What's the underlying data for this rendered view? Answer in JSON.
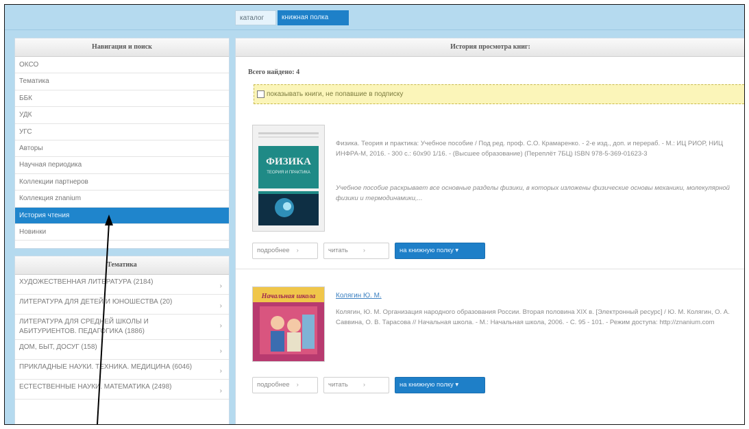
{
  "tabs": [
    {
      "label": "каталог"
    },
    {
      "label": "книжная полка"
    }
  ],
  "nav_panel": {
    "title": "Навигация и поиск",
    "items": [
      {
        "label": "ОКСО"
      },
      {
        "label": "Тематика"
      },
      {
        "label": "ББК"
      },
      {
        "label": "УДК"
      },
      {
        "label": "УГС"
      },
      {
        "label": "Авторы"
      },
      {
        "label": "Научная периодика"
      },
      {
        "label": "Коллекции партнеров"
      },
      {
        "label": "Коллекция znanium"
      },
      {
        "label": "История чтения"
      },
      {
        "label": "Новинки"
      }
    ],
    "active_index": 9
  },
  "topics_panel": {
    "title": "Тематика",
    "items": [
      {
        "label": "ХУДОЖЕСТВЕННАЯ ЛИТЕРАТУРА (2184)"
      },
      {
        "label": "ЛИТЕРАТУРА ДЛЯ ДЕТЕЙ И ЮНОШЕСТВА (20)"
      },
      {
        "label": "ЛИТЕРАТУРА ДЛЯ СРЕДНЕЙ ШКОЛЫ И АБИТУРИЕНТОВ. ПЕДАГОГИКА (1886)"
      },
      {
        "label": "ДОМ, БЫТ, ДОСУГ (158)"
      },
      {
        "label": "ПРИКЛАДНЫЕ НАУКИ. ТЕХНИКА. МЕДИЦИНА (6046)"
      },
      {
        "label": "ЕСТЕСТВЕННЫЕ НАУКИ. МАТЕМАТИКА (2498)"
      }
    ],
    "chevron": "›"
  },
  "main": {
    "title": "История просмотра книг:",
    "count_label": "Всего найдено: 4",
    "notice": "показывать книги, не попавшие в подписку",
    "books": [
      {
        "description": "Физика. Теория и практика: Учебное пособие / Под ред. проф. С.О. Крамаренко. - 2-е изд., доп. и перераб. - М.: ИЦ РИОР, НИЦ ИНФРА-М, 2016. - 300 с.: 60x90 1/16. - (Высшее образование) (Переплёт 7БЦ) ISBN 978-5-369-01623-3",
        "annotation": "Учебное пособие раскрывает все основные разделы физики, в которых изложены физические основы механики, молекулярной физики и термодинамики,...",
        "cover_title": "ФИЗИКА",
        "cover_subtitle": "ТЕОРИЯ И ПРАКТИКА",
        "details_label": "подробнее",
        "read_label": "читать",
        "shelf_label": "на книжную полку"
      },
      {
        "author": "Колягин Ю. М.",
        "description": "Колягин, Ю. М. Организация народного образования России. Вторая половина XIX в. [Электронный ресурс] / Ю. М. Колягин, О. А. Саввина, О. В. Тарасова // Начальная школа. - М.: Начальная школа, 2006. - С. 95 - 101. - Режим доступа: http://znanium.com",
        "cover_title": "Начальная школа",
        "details_label": "подробнее",
        "read_label": "читать",
        "shelf_label": "на книжную полку"
      }
    ],
    "chevron": "›",
    "caret": "▾"
  },
  "colors": {
    "accent": "#1f85cc",
    "background": "#b5daef",
    "notice_bg": "#fbf5b9"
  }
}
